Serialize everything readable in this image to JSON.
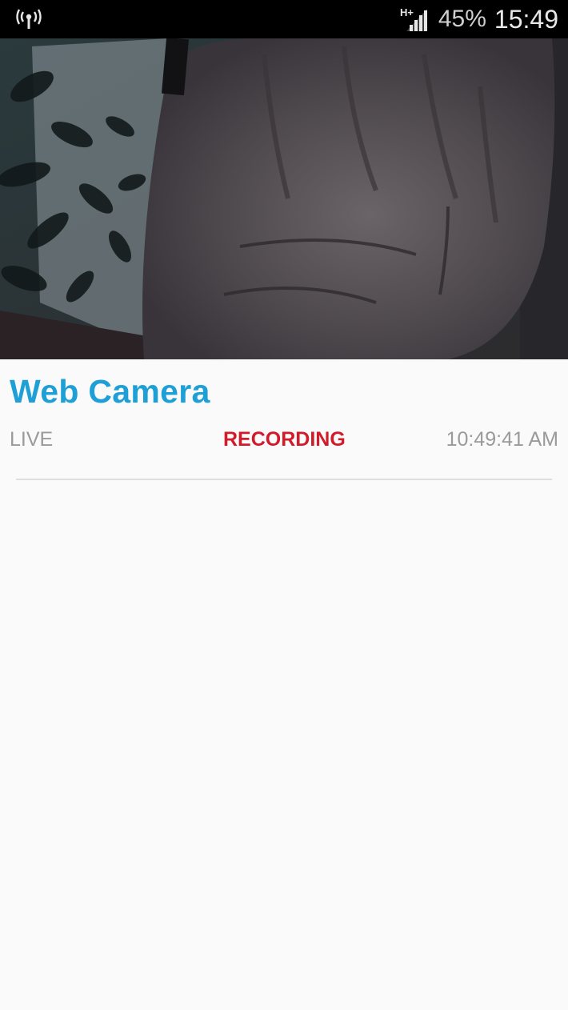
{
  "status_bar": {
    "left_icon": "wireless-broadcast-icon",
    "network_icon": "signal-hplus-icon",
    "network_type": "H+",
    "battery": "45%",
    "time": "15:49"
  },
  "camera": {
    "preview_icon": "camera-feed"
  },
  "card": {
    "title": "Web Camera",
    "live": "LIVE",
    "recording": "RECORDING",
    "timestamp": "10:49:41 AM"
  },
  "colors": {
    "title": "#1ea0d6",
    "recording": "#d11a2a",
    "muted_text": "#9a9a9a",
    "background": "#fafafa"
  }
}
